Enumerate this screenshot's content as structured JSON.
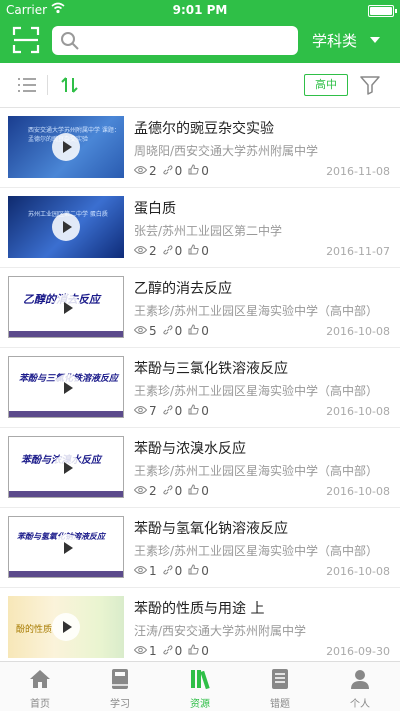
{
  "status_bar": {
    "carrier": "Carrier",
    "time": "9:01 PM"
  },
  "header": {
    "search_placeholder": "",
    "subject_label": "学科类"
  },
  "filter": {
    "level_badge": "高中"
  },
  "videos": [
    {
      "title": "孟德尔的豌豆杂交实验",
      "author": "周晓阳/西安交通大学苏州附属中学",
      "views": "2",
      "links": "0",
      "likes": "0",
      "date": "2016-11-08",
      "thumb_caption": "西安交通大学苏州附属中学 课题：孟德尔的豌豆杂交实验"
    },
    {
      "title": "蛋白质",
      "author": "张芸/苏州工业园区第二中学",
      "views": "2",
      "links": "0",
      "likes": "0",
      "date": "2016-11-07",
      "thumb_caption": "苏州工业园区第二中学 蛋白质"
    },
    {
      "title": "乙醇的消去反应",
      "author": "王素珍/苏州工业园区星海实验中学（高中部）",
      "views": "5",
      "links": "0",
      "likes": "0",
      "date": "2016-10-08",
      "thumb_caption": "乙醇的消去反应"
    },
    {
      "title": "苯酚与三氯化铁溶液反应",
      "author": "王素珍/苏州工业园区星海实验中学（高中部）",
      "views": "7",
      "links": "0",
      "likes": "0",
      "date": "2016-10-08",
      "thumb_caption": "苯酚与三氯化铁溶液反应"
    },
    {
      "title": "苯酚与浓溴水反应",
      "author": "王素珍/苏州工业园区星海实验中学（高中部）",
      "views": "2",
      "links": "0",
      "likes": "0",
      "date": "2016-10-08",
      "thumb_caption": "苯酚与浓溴水反应"
    },
    {
      "title": "苯酚与氢氧化钠溶液反应",
      "author": "王素珍/苏州工业园区星海实验中学（高中部）",
      "views": "1",
      "links": "0",
      "likes": "0",
      "date": "2016-10-08",
      "thumb_caption": "苯酚与氢氧化钠溶液反应"
    },
    {
      "title": "苯酚的性质与用途 上",
      "author": "汪涛/西安交通大学苏州附属中学",
      "views": "1",
      "links": "0",
      "likes": "0",
      "date": "2016-09-30",
      "thumb_caption": "酚的性质"
    }
  ],
  "tabs": [
    {
      "label": "首页",
      "icon": "home-icon"
    },
    {
      "label": "学习",
      "icon": "book-icon"
    },
    {
      "label": "资源",
      "icon": "library-icon"
    },
    {
      "label": "错题",
      "icon": "list-icon"
    },
    {
      "label": "个人",
      "icon": "person-icon"
    }
  ],
  "colors": {
    "brand": "#2fbf47"
  }
}
